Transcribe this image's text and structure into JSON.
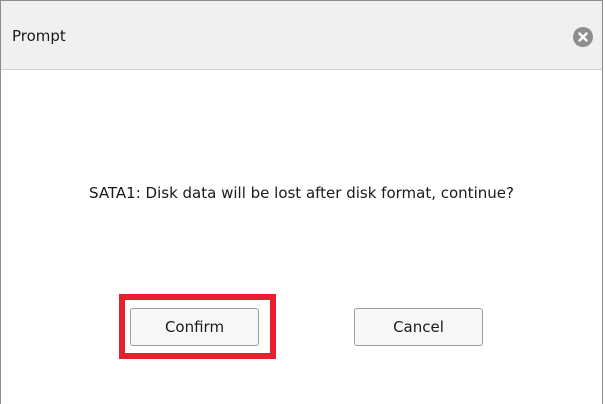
{
  "dialog": {
    "title": "Prompt",
    "close_icon": "close-circle-x-icon",
    "message": "SATA1: Disk data will be lost after disk format, continue?",
    "buttons": {
      "confirm_label": "Confirm",
      "cancel_label": "Cancel"
    },
    "highlight_color": "#e8202e"
  }
}
